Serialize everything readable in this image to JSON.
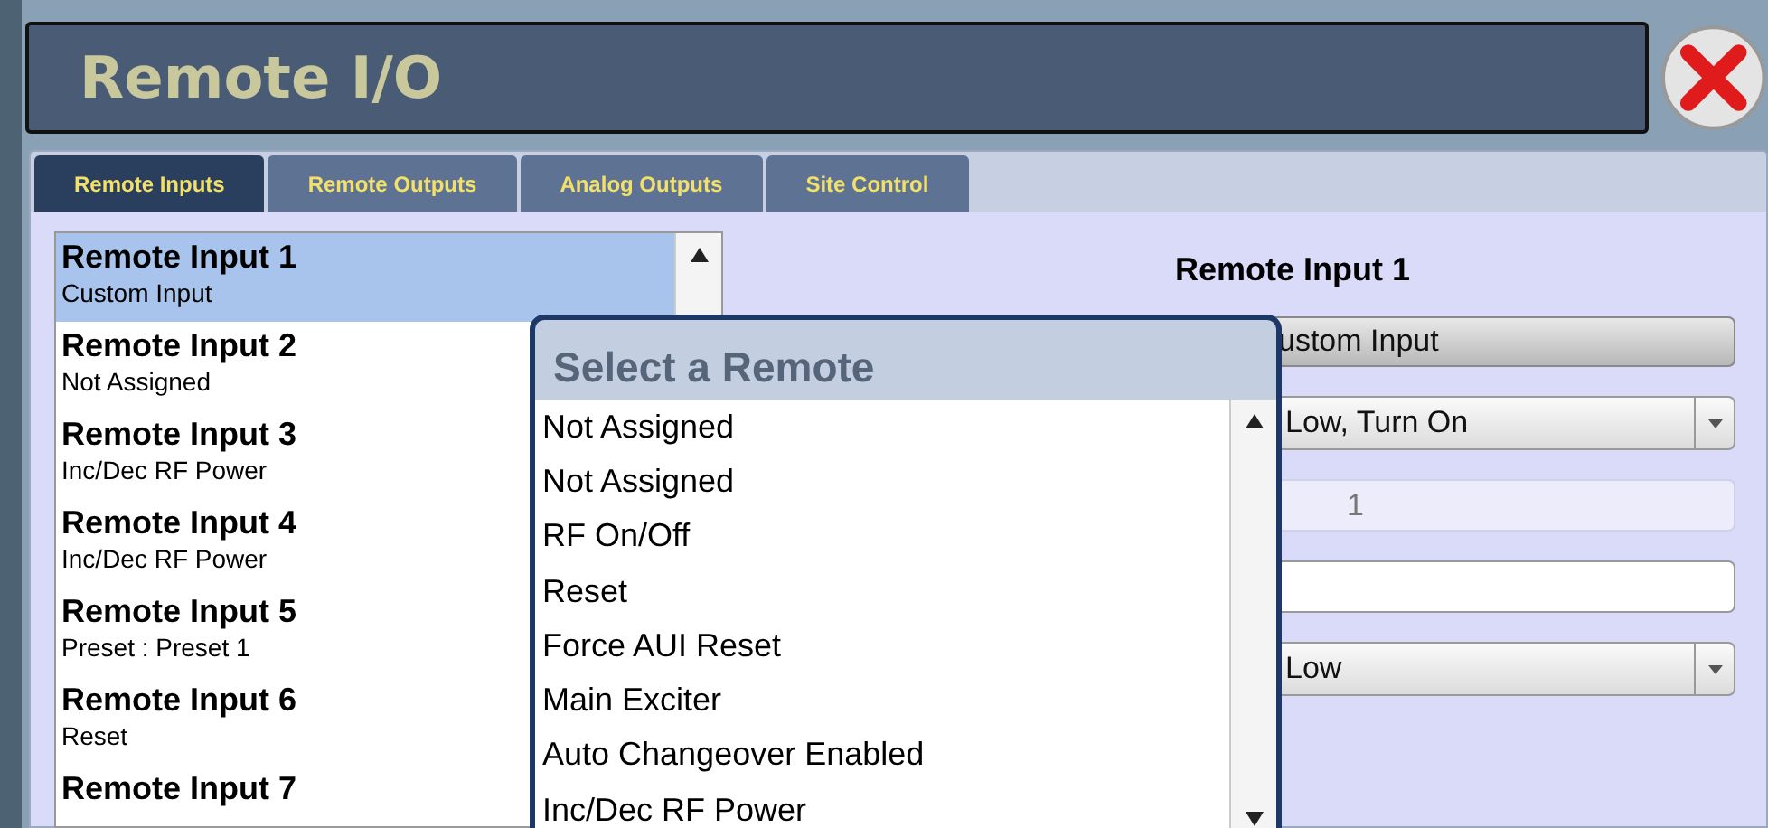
{
  "header": {
    "title": "Remote I/O"
  },
  "tabs": [
    {
      "label": "Remote Inputs",
      "selected": true
    },
    {
      "label": "Remote Outputs",
      "selected": false
    },
    {
      "label": "Analog Outputs",
      "selected": false
    },
    {
      "label": "Site Control",
      "selected": false
    }
  ],
  "inputs": [
    {
      "name": "Remote Input 1",
      "value": "Custom Input",
      "selected": true
    },
    {
      "name": "Remote Input 2",
      "value": "Not Assigned",
      "selected": false
    },
    {
      "name": "Remote Input 3",
      "value": "Inc/Dec RF Power",
      "selected": false
    },
    {
      "name": "Remote Input 4",
      "value": "Inc/Dec RF Power",
      "selected": false
    },
    {
      "name": "Remote Input 5",
      "value": "Preset : Preset 1",
      "selected": false
    },
    {
      "name": "Remote Input 6",
      "value": "Reset",
      "selected": false
    },
    {
      "name": "Remote Input 7",
      "selected": false
    }
  ],
  "detail": {
    "heading": "Remote Input 1",
    "controls": [
      {
        "kind": "button",
        "text": "ustom Input"
      },
      {
        "kind": "select",
        "text": "Low, Turn On"
      },
      {
        "kind": "readonly",
        "text": "1"
      },
      {
        "kind": "input"
      },
      {
        "kind": "select",
        "text": "Low"
      }
    ]
  },
  "popup": {
    "title": "Select a Remote",
    "options": [
      {
        "label": "Not Assigned",
        "selected": false
      },
      {
        "label": "Not Assigned",
        "selected": false
      },
      {
        "label": "RF On/Off",
        "selected": false
      },
      {
        "label": "Reset",
        "selected": false
      },
      {
        "label": "Force AUI Reset",
        "selected": false
      },
      {
        "label": "Main Exciter",
        "selected": false
      },
      {
        "label": "Auto Changeover Enabled",
        "selected": false
      },
      {
        "label": "Inc/Dec RF Power",
        "selected": false
      }
    ]
  }
}
